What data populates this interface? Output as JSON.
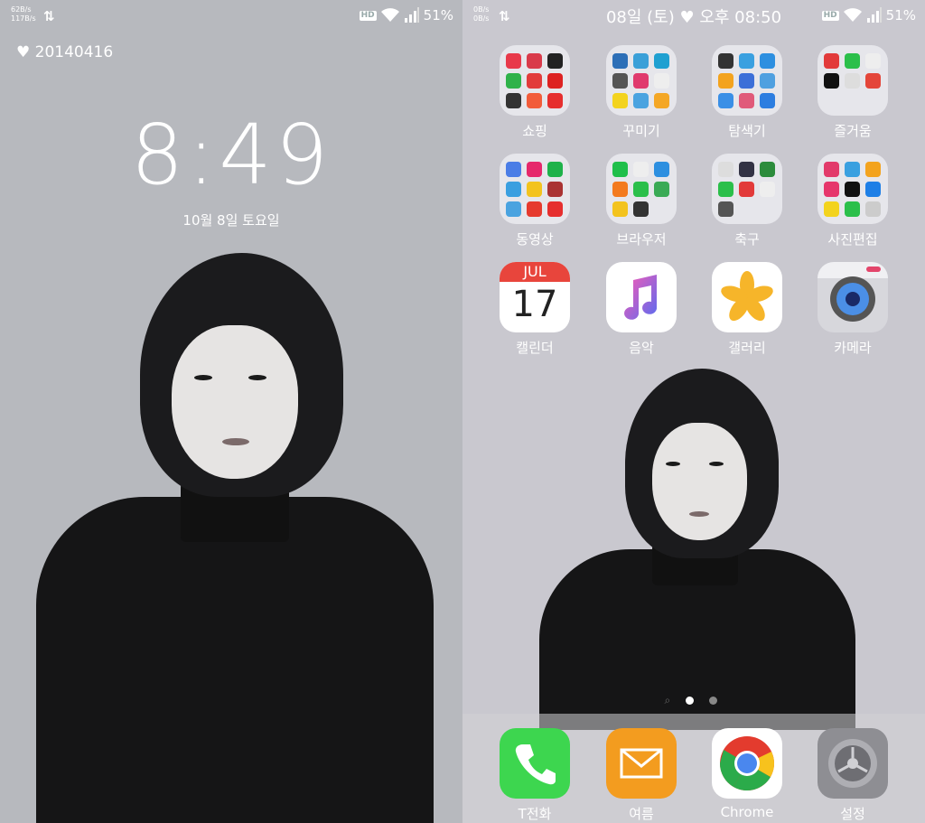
{
  "lock": {
    "net_up": "62B/s",
    "net_down": "117B/s",
    "hd": "HD",
    "battery": "51%",
    "heart_date": "♥ 20140416",
    "time": "8:49",
    "date": "10월 8일 토요일"
  },
  "home": {
    "net_up": "0B/s",
    "net_down": "0B/s",
    "status_center": "08일 (토) ♥ 오후 08:50",
    "hd": "HD",
    "battery": "51%",
    "folders": [
      {
        "label": "쇼핑"
      },
      {
        "label": "꾸미기"
      },
      {
        "label": "탐색기"
      },
      {
        "label": "즐거움"
      },
      {
        "label": "동영상"
      },
      {
        "label": "브라우저"
      },
      {
        "label": "축구"
      },
      {
        "label": "사진편집"
      }
    ],
    "apps": {
      "calendar": {
        "label": "캘린더",
        "month": "JUL",
        "day": "17"
      },
      "music": {
        "label": "음악"
      },
      "gallery": {
        "label": "갤러리"
      },
      "camera": {
        "label": "카메라"
      }
    },
    "page_indicator": {
      "current": 2,
      "total": 2
    },
    "dock": [
      {
        "label": "T전화"
      },
      {
        "label": "여름"
      },
      {
        "label": "Chrome"
      },
      {
        "label": "설정"
      }
    ]
  },
  "colors": {
    "lock_bg": "#b7b9be",
    "home_bg": "#c9c8cf",
    "phone_green": "#3dd64f",
    "mail_orange": "#f39c1f"
  }
}
